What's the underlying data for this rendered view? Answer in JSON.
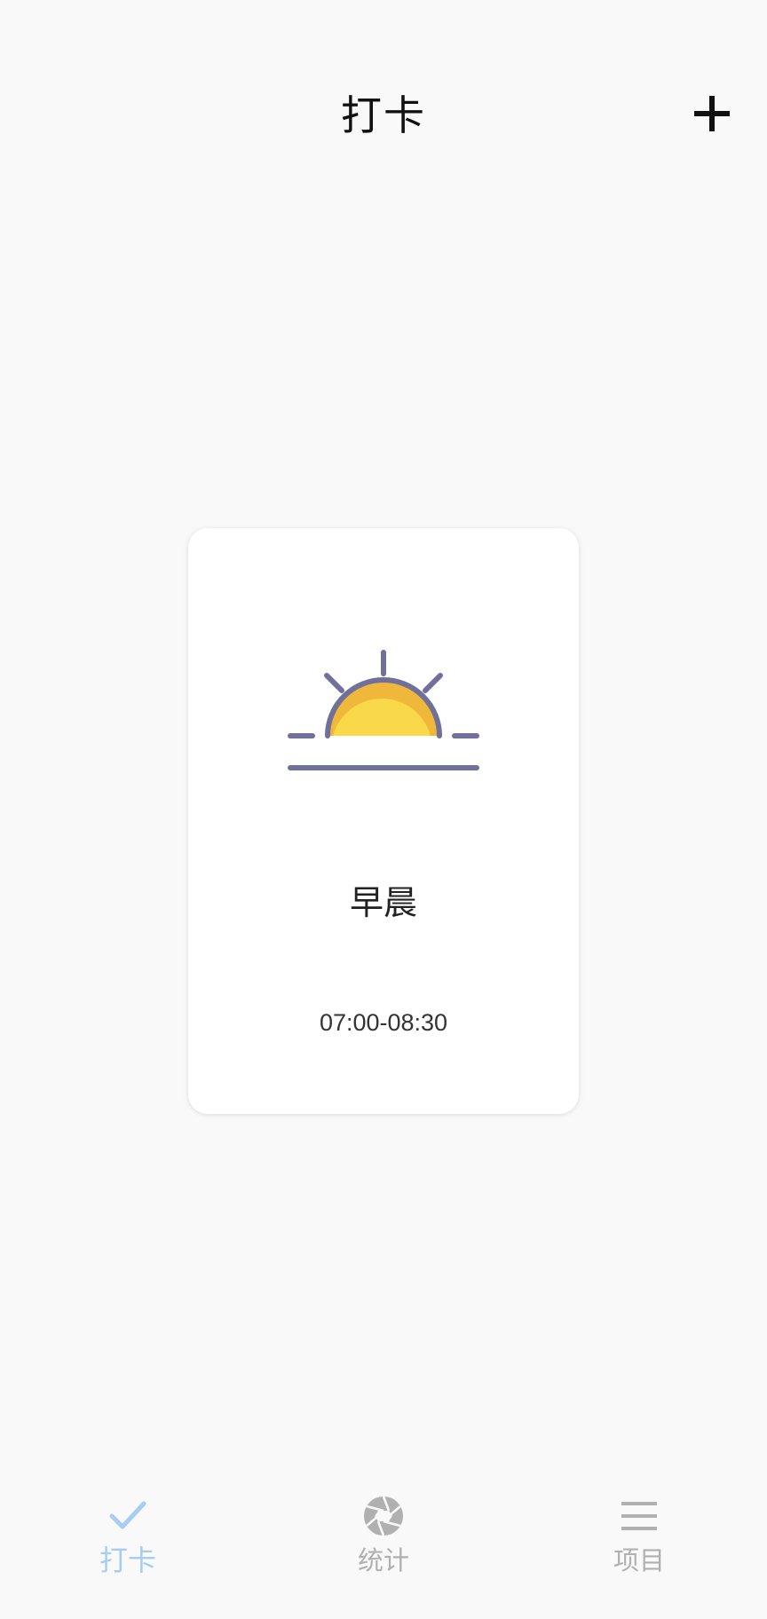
{
  "header": {
    "title": "打卡",
    "add_icon": "plus-icon"
  },
  "card": {
    "icon": "sunrise-icon",
    "name": "早晨",
    "time": "07:00-08:30",
    "colors": {
      "sun": "#f9d84a",
      "sun_shade": "#f0b83a",
      "outline": "#70709a"
    }
  },
  "tabbar": {
    "active_color": "#a7cdf1",
    "inactive_color": "#b0b0b0",
    "items": [
      {
        "label": "打卡",
        "icon": "check-icon",
        "active": true
      },
      {
        "label": "统计",
        "icon": "aperture-icon",
        "active": false
      },
      {
        "label": "项目",
        "icon": "menu-lines-icon",
        "active": false
      }
    ]
  }
}
